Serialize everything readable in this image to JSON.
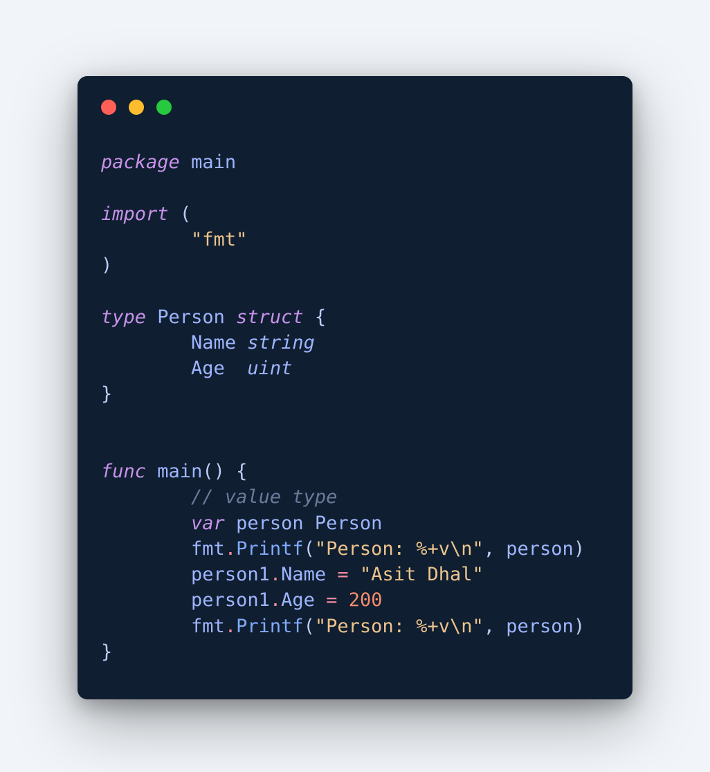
{
  "window": {
    "dots": [
      "red",
      "yellow",
      "green"
    ]
  },
  "code": {
    "kw_package": "package",
    "pkg_name": "main",
    "kw_import": "import",
    "imp_open": "(",
    "imp_fmt": "\"fmt\"",
    "imp_close": ")",
    "kw_type": "type",
    "type_name": "Person",
    "kw_struct": "struct",
    "brace_open": "{",
    "field_name": "Name",
    "type_string": "string",
    "field_age": "Age",
    "type_uint": "uint",
    "brace_close": "}",
    "kw_func": "func",
    "fn_main": "main",
    "fn_main_parens": "()",
    "fn_main_brace": "{",
    "comment_value_type": "// value type",
    "kw_var": "var",
    "var_person": "person",
    "var_person_type": "Person",
    "ident_fmt": "fmt",
    "dot": ".",
    "fn_printf": "Printf",
    "str_printf": "\"Person: %+v\\n\"",
    "comma": ",",
    "paren_open": "(",
    "paren_close": ")",
    "ident_person": "person",
    "ident_person1": "person1",
    "field_name2": "Name",
    "eq": "=",
    "str_asit": "\"Asit Dhal\"",
    "field_age2": "Age",
    "num_200": "200",
    "fn_brace_close": "}"
  }
}
